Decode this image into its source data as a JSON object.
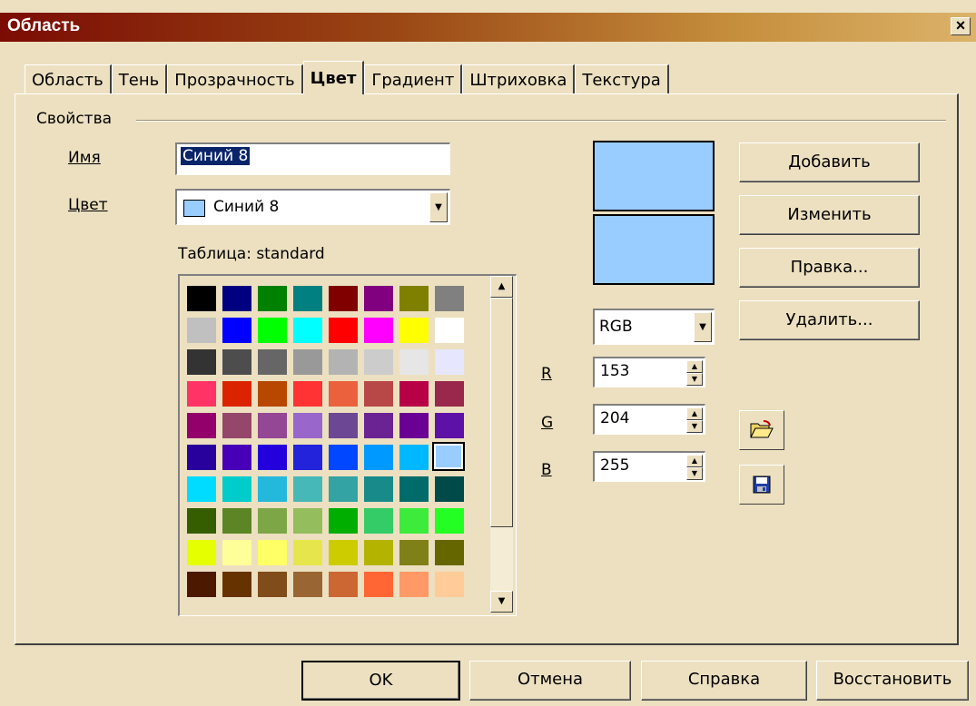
{
  "window": {
    "title": "Область",
    "close": "×"
  },
  "tabs": [
    {
      "label": "Область"
    },
    {
      "label": "Тень"
    },
    {
      "label": "Прозрачность"
    },
    {
      "label": "Цвет"
    },
    {
      "label": "Градиент"
    },
    {
      "label": "Штриховка"
    },
    {
      "label": "Текстура"
    }
  ],
  "active_tab": "Цвет",
  "properties": {
    "group_label": "Свойства",
    "name_label": "Имя",
    "name_value": "Синий 8",
    "color_label": "Цвет",
    "color_value": "Синий 8",
    "color_swatch": "#99ccff",
    "table_label": "Таблица: standard"
  },
  "palette": {
    "selected": "#99ccff",
    "rows": [
      [
        "#000000",
        "#000080",
        "#008000",
        "#008080",
        "#800000",
        "#800080",
        "#808000",
        "#808080"
      ],
      [
        "#c0c0c0",
        "#0000ff",
        "#00ff00",
        "#00ffff",
        "#ff0000",
        "#ff00ff",
        "#ffff00",
        "#ffffff"
      ],
      [
        "#333333",
        "#4d4d4d",
        "#666666",
        "#999999",
        "#b3b3b3",
        "#cccccc",
        "#e6e6e6",
        "#e6e6ff"
      ],
      [
        "#ff3366",
        "#dc2300",
        "#b84700",
        "#ff3333",
        "#eb613d",
        "#b84747",
        "#b80047",
        "#99284c"
      ],
      [
        "#94006b",
        "#94476b",
        "#944794",
        "#9966cc",
        "#6b4794",
        "#6b2394",
        "#6b0094",
        "#5e11a6"
      ],
      [
        "#28009c",
        "#4700b8",
        "#2300dc",
        "#2323dc",
        "#0047ff",
        "#0099ff",
        "#00b8ff",
        "#99ccff"
      ],
      [
        "#00dcff",
        "#00cccc",
        "#23b8dc",
        "#47b8b8",
        "#33a3a3",
        "#198a8a",
        "#006b6b",
        "#004a4a"
      ],
      [
        "#355e00",
        "#5c8526",
        "#7da647",
        "#94bd5e",
        "#00ae00",
        "#33cc66",
        "#3deb3d",
        "#23ff23"
      ],
      [
        "#e6ff00",
        "#ffff99",
        "#ffff66",
        "#e6e64c",
        "#cccc00",
        "#b3b300",
        "#808019",
        "#666600"
      ],
      [
        "#4c1900",
        "#663300",
        "#804c19",
        "#996633",
        "#cc6633",
        "#ff6633",
        "#ff9966",
        "#ffcc99"
      ]
    ]
  },
  "preview": {
    "top": "#99ccff",
    "bottom": "#99ccff"
  },
  "color_model": {
    "value": "RGB"
  },
  "rgb": {
    "r_label": "R",
    "r_value": "153",
    "g_label": "G",
    "g_value": "204",
    "b_label": "B",
    "b_value": "255"
  },
  "side_buttons": {
    "add": "Добавить",
    "modify": "Изменить",
    "edit": "Правка...",
    "delete": "Удалить..."
  },
  "icons": {
    "open": "folder-open-icon",
    "save": "floppy-disk-icon"
  },
  "bottom_buttons": {
    "ok": "OK",
    "cancel": "Отмена",
    "help": "Справка",
    "reset": "Восстановить"
  }
}
